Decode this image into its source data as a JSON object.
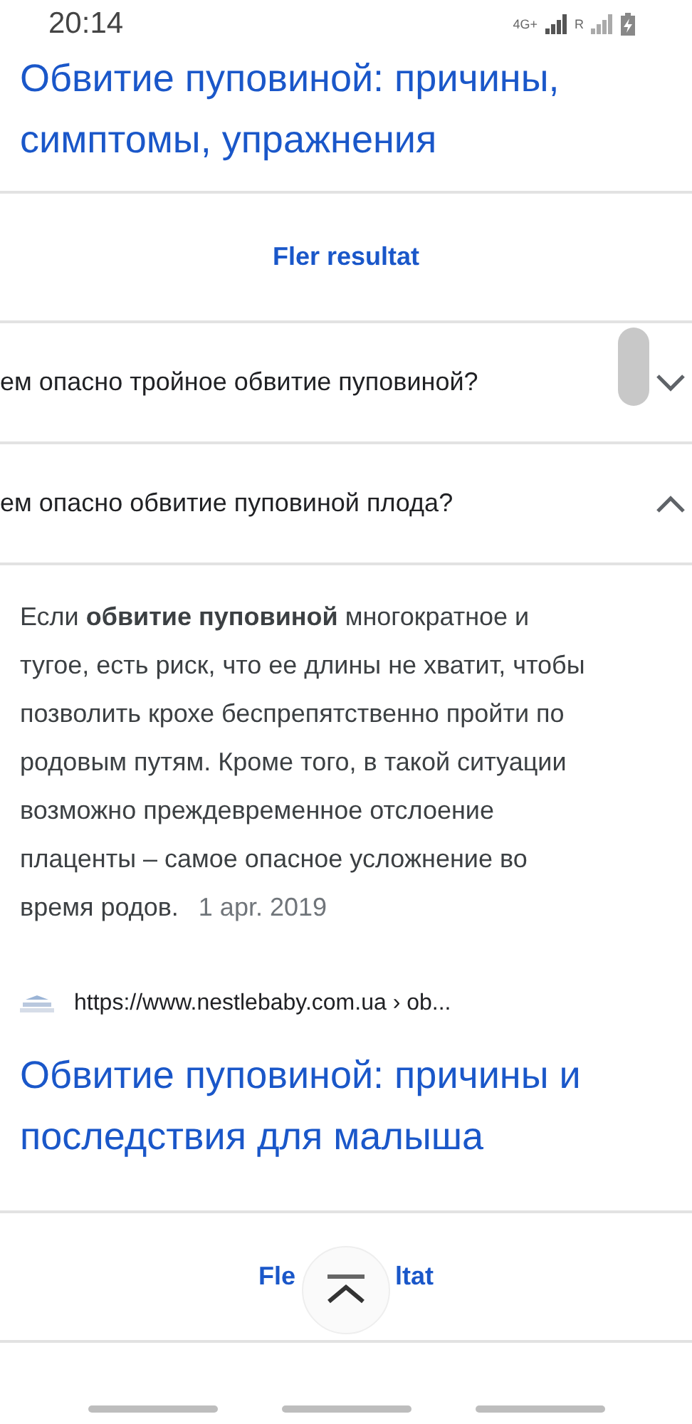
{
  "status_bar": {
    "time": "20:14",
    "network": "4G+",
    "roaming": "R"
  },
  "top_result": {
    "title": "Обвитие пуповиной: причины, симптомы, упражнения"
  },
  "more_results_top": {
    "label": "Fler resultat"
  },
  "questions": [
    {
      "text": "ем опасно тройное обвитие пуповиной?",
      "expanded": false
    },
    {
      "text": "ем опасно обвитие пуповиной плода?",
      "expanded": true
    }
  ],
  "answer": {
    "text": "Если **обвитие пуповиной** многократное и тугое, есть риск, что ее длины не хватит, чтобы позволить крохе беспрепятственно пройти по родовым путям. Кроме того, в такой ситуации возможно преждевременное отслоение плаценты – самое опасное усложнение во время родов.",
    "date": "1 apr. 2019",
    "source_url": "https://www.nestlebaby.com.ua › ob...",
    "source_title": "Обвитие пуповиной: причины и последствия для малыша"
  },
  "more_results_bottom": {
    "left_part": "Fle",
    "right_part": "ltat"
  }
}
